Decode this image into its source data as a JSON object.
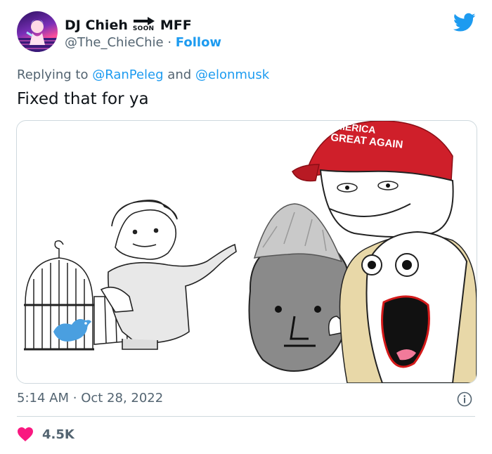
{
  "author": {
    "display_name": "DJ Chieh",
    "badge_small_text": "SOON",
    "badge_suffix": "MFF",
    "handle": "@The_ChieChie",
    "separator": "·",
    "follow_label": "Follow"
  },
  "reply": {
    "prefix": "Replying to",
    "mention_1": "@RanPeleg",
    "conjunction": "and",
    "mention_2": "@elonmusk"
  },
  "tweet": {
    "text": "Fixed that for ya"
  },
  "media": {
    "hat_line_1": "MERICA",
    "hat_line_2": "GREAT AGAIN"
  },
  "meta": {
    "time": "5:14 AM",
    "separator": "·",
    "date": "Oct 28, 2022"
  },
  "engagement": {
    "likes": "4.5K"
  },
  "colors": {
    "link": "#1d9bf0",
    "muted": "#536471",
    "heart": "#f91880",
    "border": "#cfd9de"
  },
  "icons": {
    "brand": "twitter-bird-icon",
    "info": "info-circle-icon",
    "like": "heart-icon",
    "arrow": "right-arrow-icon"
  }
}
